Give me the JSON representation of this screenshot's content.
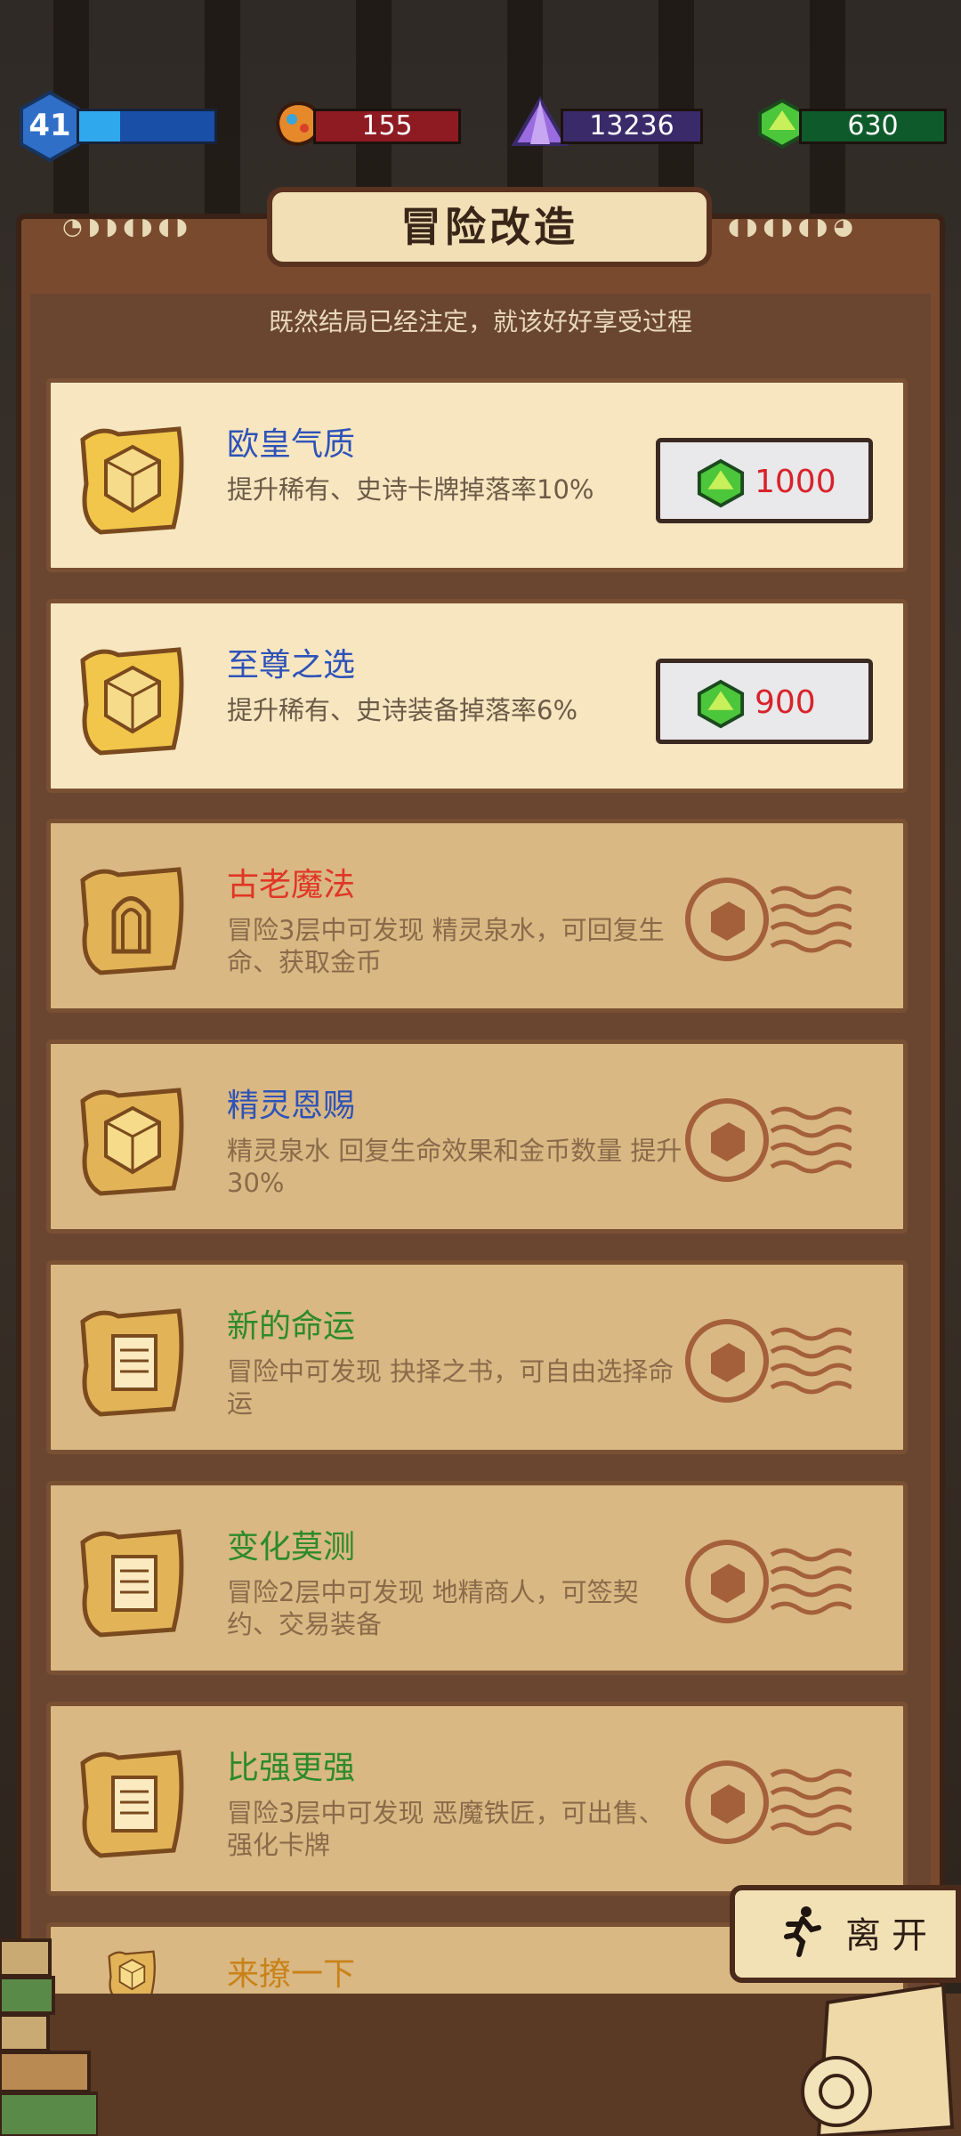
{
  "hud": {
    "level": "41",
    "xp_fraction": 0.3,
    "resources": [
      {
        "name": "ore",
        "icon": "ore-icon",
        "value": "155",
        "color": "#8e1a22"
      },
      {
        "name": "crystal",
        "icon": "purple-crystal-icon",
        "value": "13236",
        "color": "#3a2a6a"
      },
      {
        "name": "gem",
        "icon": "green-gem-icon",
        "value": "630",
        "color": "#0f5a2a"
      }
    ]
  },
  "title": "冒险改造",
  "subtitle": "既然结局已经注定，就该好好享受过程",
  "cards": [
    {
      "title": "欧皇气质",
      "desc": "提升稀有、史诗卡牌掉落率10%",
      "title_color": "#2e52b8",
      "state": "unlocked",
      "price": "1000",
      "icon": "dice-scroll-icon"
    },
    {
      "title": "至尊之选",
      "desc": "提升稀有、史诗装备掉落率6%",
      "title_color": "#2e52b8",
      "state": "unlocked",
      "price": "900",
      "icon": "dice-scroll-icon"
    },
    {
      "title": "古老魔法",
      "desc": "冒险3层中可发现 精灵泉水，可回复生命、获取金币",
      "title_color": "#e03626",
      "state": "locked",
      "icon": "portal-scroll-icon"
    },
    {
      "title": "精灵恩赐",
      "desc": "精灵泉水 回复生命效果和金币数量 提升 30%",
      "title_color": "#2e52b8",
      "state": "locked",
      "icon": "dice-scroll-icon"
    },
    {
      "title": "新的命运",
      "desc": "冒险中可发现 抉择之书，可自由选择命运",
      "title_color": "#2d8a2a",
      "state": "locked",
      "icon": "book-scroll-icon"
    },
    {
      "title": "变化莫测",
      "desc": "冒险2层中可发现 地精商人，可签契约、交易装备",
      "title_color": "#2d8a2a",
      "state": "locked",
      "icon": "book-scroll-icon"
    },
    {
      "title": "比强更强",
      "desc": "冒险3层中可发现 恶魔铁匠，可出售、强化卡牌",
      "title_color": "#2d8a2a",
      "state": "locked",
      "icon": "book-scroll-icon"
    },
    {
      "title": "来撩一下",
      "desc": "",
      "title_color": "#c9821a",
      "state": "locked",
      "icon": "dice-scroll-icon"
    }
  ],
  "leave_label": "离开"
}
